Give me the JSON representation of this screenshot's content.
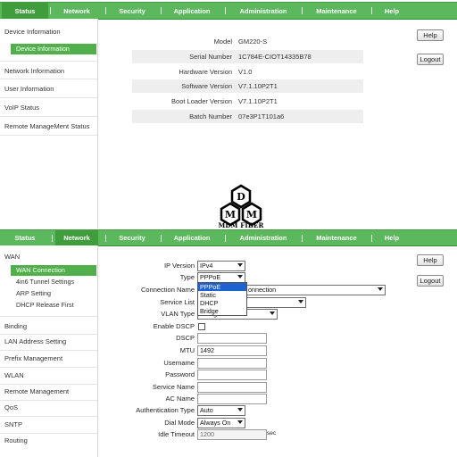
{
  "top_panel": {
    "nav": [
      "Status",
      "Network",
      "Security",
      "Application",
      "Administration",
      "Maintenance",
      "Help"
    ],
    "active_nav": "Status",
    "sidebar": {
      "group": "Device Information",
      "sub_active": "Device Information",
      "items": [
        "Network Information",
        "User Information",
        "VoIP Status",
        "Remote ManageMent Status"
      ]
    },
    "device_info": [
      {
        "label": "Model",
        "value": "GM220-S"
      },
      {
        "label": "Serial Number",
        "value": "1C784E-CIOT14335B78"
      },
      {
        "label": "Hardware Version",
        "value": "V1.0"
      },
      {
        "label": "Software Version",
        "value": "V7.1.10P2T1"
      },
      {
        "label": "Boot Loader Version",
        "value": "V7.1.10P2T1"
      },
      {
        "label": "Batch Number",
        "value": "07e3P1T101a6"
      }
    ],
    "help_label": "Help",
    "logout_label": "Logout"
  },
  "watermark": {
    "letters": [
      "D",
      "M",
      "M"
    ],
    "text": "MDM FIBER"
  },
  "bottom_panel": {
    "nav": [
      "Status",
      "Network",
      "Security",
      "Application",
      "Administration",
      "Maintenance",
      "Help"
    ],
    "active_nav": "Network",
    "sidebar": {
      "group": "WAN",
      "subitems": [
        "WAN Connection",
        "4in6 Tunnel Settings",
        "ARP Setting",
        "DHCP Release First"
      ],
      "sub_active": "WAN Connection",
      "items": [
        "Binding",
        "LAN Address Setting",
        "Prefix Management",
        "WLAN",
        "Remote Management",
        "QoS",
        "SNTP",
        "Routing"
      ]
    },
    "form": {
      "ip_version": {
        "label": "IP Version",
        "value": "IPv4"
      },
      "type": {
        "label": "Type",
        "value": "PPPoE",
        "options": [
          "PPPoE",
          "Static",
          "DHCP",
          "Bridge"
        ]
      },
      "connection_name": {
        "label": "Connection Name",
        "value": "onnection"
      },
      "service_list": {
        "label": "Service List",
        "value": ""
      },
      "vlan_type": {
        "label": "VLAN Type",
        "value": "Untag"
      },
      "enable_dscp": {
        "label": "Enable DSCP"
      },
      "dscp": {
        "label": "DSCP",
        "value": ""
      },
      "mtu": {
        "label": "MTU",
        "value": "1492"
      },
      "username": {
        "label": "Username",
        "value": ""
      },
      "password": {
        "label": "Password",
        "value": ""
      },
      "service_name": {
        "label": "Service Name",
        "value": ""
      },
      "ac_name": {
        "label": "AC Name",
        "value": ""
      },
      "auth_type": {
        "label": "Authentication Type",
        "value": "Auto"
      },
      "dial_mode": {
        "label": "Dial Mode",
        "value": "Always On"
      },
      "idle_timeout": {
        "label": "Idle Timeout",
        "value": "1200",
        "unit": "sec"
      }
    },
    "help_label": "Help",
    "logout_label": "Logout"
  },
  "colors": {
    "nav_green": "#5cb85c",
    "nav_active": "#3f9d3b",
    "sidebar_active": "#52b04c",
    "dropdown_highlight": "#1e62d0"
  }
}
